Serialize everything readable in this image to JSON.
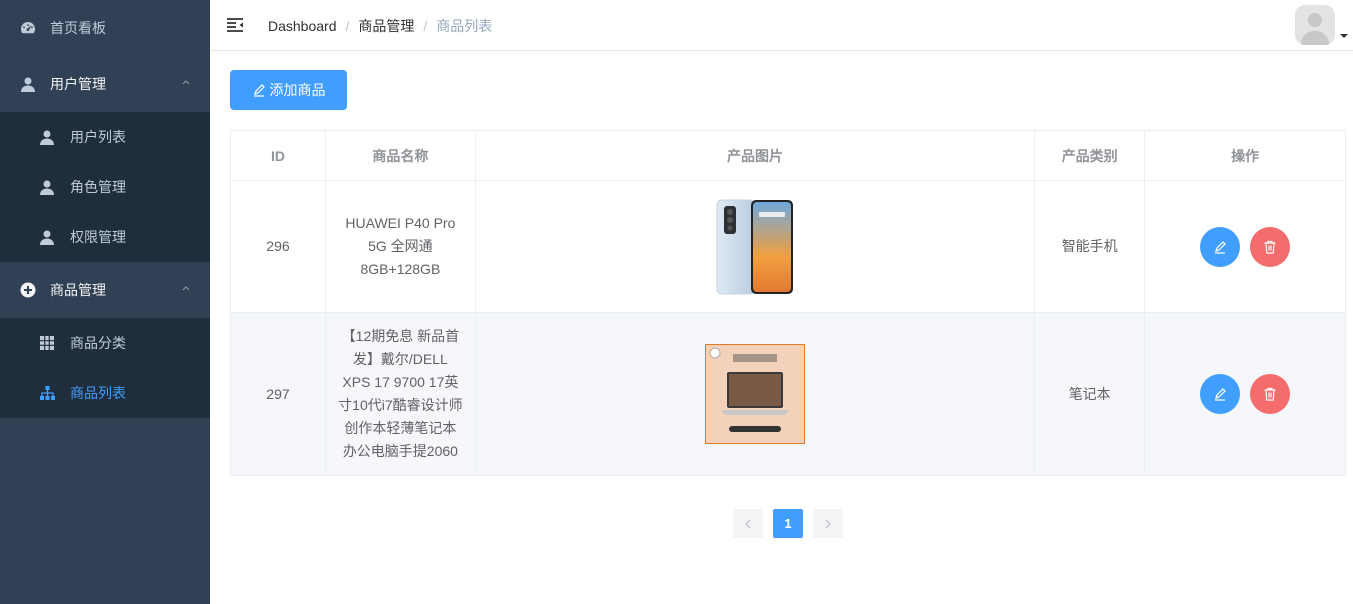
{
  "sidebar": {
    "items": [
      {
        "label": "首页看板",
        "icon": "dashboard-icon"
      },
      {
        "label": "用户管理",
        "icon": "user-icon"
      },
      {
        "label": "用户列表",
        "icon": "user-icon"
      },
      {
        "label": "角色管理",
        "icon": "user-icon"
      },
      {
        "label": "权限管理",
        "icon": "user-icon"
      },
      {
        "label": "商品管理",
        "icon": "plus-circle-icon"
      },
      {
        "label": "商品分类",
        "icon": "grid-icon"
      },
      {
        "label": "商品列表",
        "icon": "sitemap-icon"
      }
    ],
    "active": "商品列表"
  },
  "header": {
    "breadcrumb": [
      "Dashboard",
      "商品管理",
      "商品列表"
    ],
    "separator": "/"
  },
  "toolbar": {
    "add_label": "添加商品"
  },
  "table": {
    "columns": [
      "ID",
      "商品名称",
      "产品图片",
      "产品类别",
      "操作"
    ],
    "rows": [
      {
        "id": "296",
        "name": "HUAWEI P40 Pro 5G 全网通 8GB+128GB",
        "category": "智能手机",
        "image": "phone-image"
      },
      {
        "id": "297",
        "name": "【12期免息 新品首发】戴尔/DELL XPS 17 9700 17英寸10代i7酷睿设计师创作本轻薄笔记本办公电脑手提2060",
        "category": "笔记本",
        "image": "laptop-image"
      }
    ]
  },
  "pagination": {
    "current": "1"
  },
  "colors": {
    "sidebar_bg": "#304156",
    "submenu_bg": "#1f2d3d",
    "primary": "#409eff",
    "danger": "#f56c6c"
  }
}
